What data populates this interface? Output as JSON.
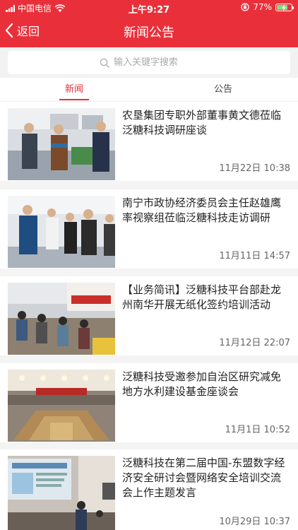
{
  "status_bar": {
    "carrier": "中国电信",
    "time": "上午9:27",
    "battery": "77%",
    "battery_level": 0.77
  },
  "nav": {
    "back_label": "返回",
    "title": "新闻公告"
  },
  "search": {
    "placeholder": "输入关键字搜索"
  },
  "tabs": [
    {
      "label": "新闻",
      "active": true
    },
    {
      "label": "公告",
      "active": false
    }
  ],
  "colors": {
    "brand": "#e9303a"
  },
  "news": [
    {
      "title": "农垦集团专职外部董事黄文德莅临泛糖科技调研座谈",
      "date": "11月22日  10:38"
    },
    {
      "title": "南宁市政协经济委员会主任赵雄鹰率视察组莅临泛糖科技走访调研",
      "date": "11月11日  14:57"
    },
    {
      "title": "【业务简讯】泛糖科技平台部赴龙州南华开展无纸化签约培训活动",
      "date": "11月12日  22:07"
    },
    {
      "title": "泛糖科技受邀参加自治区研究减免地方水利建设基金座谈会",
      "date": "11月1日  10:52"
    },
    {
      "title": "泛糖科技在第二届中国-东盟数字经济安全研讨会暨网络安全培训交流会上作主题发言",
      "date": "10月29日  10:37"
    }
  ]
}
